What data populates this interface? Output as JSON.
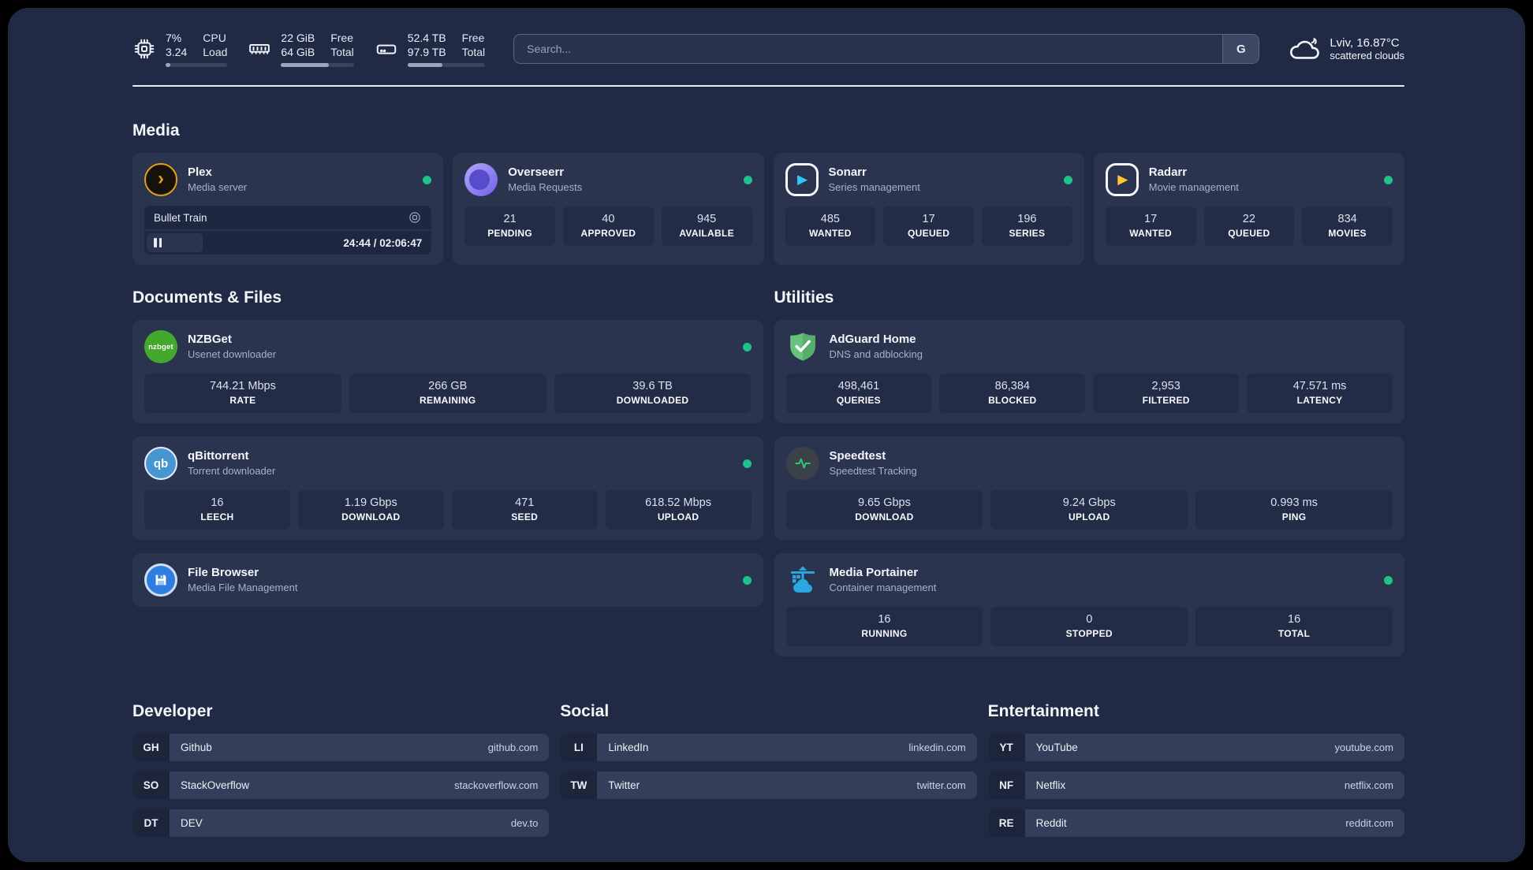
{
  "colors": {
    "background": "#202a45",
    "card": "#2a344f",
    "status_green": "#1ec28b",
    "plex_amber": "#e5a00d",
    "sonarr_blue": "#35c5f4",
    "radarr_amber": "#ffc230",
    "nzbget_green": "#44a82c",
    "qbittorrent_blue": "#4796d2",
    "portainer_blue": "#2aa8e0",
    "adguard_green": "#5fbf75"
  },
  "header": {
    "cpu": {
      "usage": "7%",
      "load": "3.24",
      "label_top": "CPU",
      "label_bottom": "Load",
      "progress_pct": 8
    },
    "memory": {
      "free": "22 GiB",
      "total": "64 GiB",
      "label_top": "Free",
      "label_bottom": "Total",
      "progress_pct": 66
    },
    "storage": {
      "free": "52.4 TB",
      "total": "97.9 TB",
      "label_top": "Free",
      "label_bottom": "Total",
      "progress_pct": 45
    },
    "search": {
      "placeholder": "Search...",
      "engine_label": "G"
    },
    "weather": {
      "location": "Lviv, 16.87°C",
      "condition": "scattered clouds"
    }
  },
  "sections": {
    "media": "Media",
    "documents": "Documents & Files",
    "utilities": "Utilities",
    "developer": "Developer",
    "social": "Social",
    "entertainment": "Entertainment"
  },
  "apps": {
    "plex": {
      "name": "Plex",
      "description": "Media server",
      "status": "online",
      "player": {
        "title": "Bullet Train",
        "time": "24:44 / 02:06:47",
        "progress_pct": 19.5
      }
    },
    "overseerr": {
      "name": "Overseerr",
      "description": "Media Requests",
      "status": "online",
      "stats": [
        {
          "value": "21",
          "label": "PENDING"
        },
        {
          "value": "40",
          "label": "APPROVED"
        },
        {
          "value": "945",
          "label": "AVAILABLE"
        }
      ]
    },
    "sonarr": {
      "name": "Sonarr",
      "description": "Series management",
      "status": "online",
      "stats": [
        {
          "value": "485",
          "label": "WANTED"
        },
        {
          "value": "17",
          "label": "QUEUED"
        },
        {
          "value": "196",
          "label": "SERIES"
        }
      ]
    },
    "radarr": {
      "name": "Radarr",
      "description": "Movie management",
      "status": "online",
      "stats": [
        {
          "value": "17",
          "label": "WANTED"
        },
        {
          "value": "22",
          "label": "QUEUED"
        },
        {
          "value": "834",
          "label": "MOVIES"
        }
      ]
    },
    "nzbget": {
      "name": "NZBGet",
      "description": "Usenet downloader",
      "status": "online",
      "logo_text": "nzbget",
      "stats": [
        {
          "value": "744.21 Mbps",
          "label": "RATE"
        },
        {
          "value": "266 GB",
          "label": "REMAINING"
        },
        {
          "value": "39.6 TB",
          "label": "DOWNLOADED"
        }
      ]
    },
    "qbittorrent": {
      "name": "qBittorrent",
      "description": "Torrent downloader",
      "status": "online",
      "logo_text": "qb",
      "stats": [
        {
          "value": "16",
          "label": "LEECH"
        },
        {
          "value": "1.19 Gbps",
          "label": "DOWNLOAD"
        },
        {
          "value": "471",
          "label": "SEED"
        },
        {
          "value": "618.52 Mbps",
          "label": "UPLOAD"
        }
      ]
    },
    "filebrowser": {
      "name": "File Browser",
      "description": "Media File Management",
      "status": "online"
    },
    "adguard": {
      "name": "AdGuard Home",
      "description": "DNS and adblocking",
      "stats": [
        {
          "value": "498,461",
          "label": "QUERIES"
        },
        {
          "value": "86,384",
          "label": "BLOCKED"
        },
        {
          "value": "2,953",
          "label": "FILTERED"
        },
        {
          "value": "47.571 ms",
          "label": "LATENCY"
        }
      ]
    },
    "speedtest": {
      "name": "Speedtest",
      "description": "Speedtest Tracking",
      "stats": [
        {
          "value": "9.65 Gbps",
          "label": "DOWNLOAD"
        },
        {
          "value": "9.24 Gbps",
          "label": "UPLOAD"
        },
        {
          "value": "0.993 ms",
          "label": "PING"
        }
      ]
    },
    "portainer": {
      "name": "Media Portainer",
      "description": "Container management",
      "status": "online",
      "stats": [
        {
          "value": "16",
          "label": "RUNNING"
        },
        {
          "value": "0",
          "label": "STOPPED"
        },
        {
          "value": "16",
          "label": "TOTAL"
        }
      ]
    }
  },
  "bookmarks": {
    "developer": [
      {
        "abbr": "GH",
        "name": "Github",
        "url": "github.com"
      },
      {
        "abbr": "SO",
        "name": "StackOverflow",
        "url": "stackoverflow.com"
      },
      {
        "abbr": "DT",
        "name": "DEV",
        "url": "dev.to"
      }
    ],
    "social": [
      {
        "abbr": "LI",
        "name": "LinkedIn",
        "url": "linkedin.com"
      },
      {
        "abbr": "TW",
        "name": "Twitter",
        "url": "twitter.com"
      }
    ],
    "entertainment": [
      {
        "abbr": "YT",
        "name": "YouTube",
        "url": "youtube.com"
      },
      {
        "abbr": "NF",
        "name": "Netflix",
        "url": "netflix.com"
      },
      {
        "abbr": "RE",
        "name": "Reddit",
        "url": "reddit.com"
      }
    ]
  }
}
